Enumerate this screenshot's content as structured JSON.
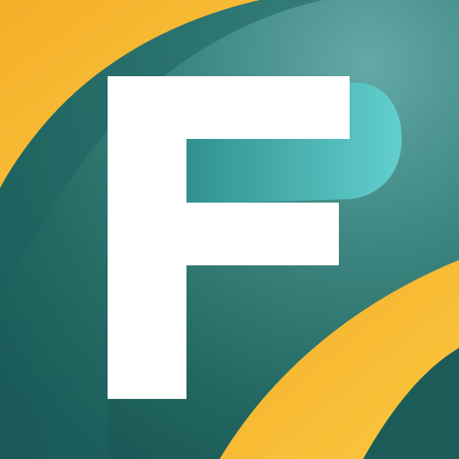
{
  "app_icon": {
    "letter": "F",
    "colors": {
      "background_dark": "#175755",
      "background_mid": "#2d7a75",
      "background_glow": "#64a9a6",
      "accent_yellow": "#f7b731",
      "accent_yellow_light": "#fbc83f",
      "letter_white": "#ffffff",
      "bowl_teal": "#5cc9c9"
    }
  }
}
